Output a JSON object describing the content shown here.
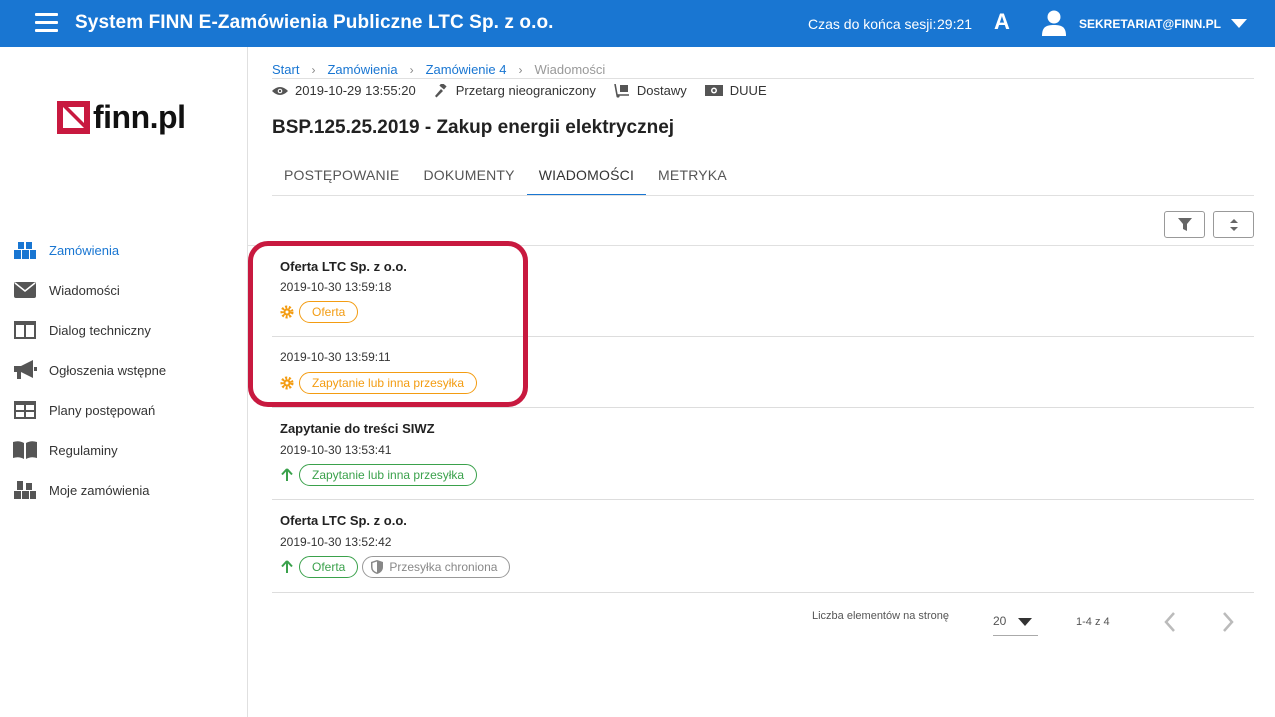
{
  "header": {
    "title": "System FINN E-Zamówienia Publiczne LTC Sp. z o.o.",
    "session_label": "Czas do końca sesji:",
    "session_time": "29:21",
    "font_toggle": "A",
    "user": "SEKRETARIAT@FINN.PL",
    "background": "#1976d2"
  },
  "sidebar": {
    "logo_text": "finn.pl",
    "logo_color": "#c8193f",
    "items": [
      {
        "label": "Zamówienia",
        "icon": "boxes-icon",
        "active": true
      },
      {
        "label": "Wiadomości",
        "icon": "envelope-icon"
      },
      {
        "label": "Dialog techniczny",
        "icon": "columns-icon"
      },
      {
        "label": "Ogłoszenia wstępne",
        "icon": "megaphone-icon"
      },
      {
        "label": "Plany postępowań",
        "icon": "table-icon"
      },
      {
        "label": "Regulaminy",
        "icon": "book-icon"
      },
      {
        "label": "Moje zamówienia",
        "icon": "stacked-boxes-icon"
      }
    ]
  },
  "breadcrumb": {
    "items": [
      "Start",
      "Zamówienia",
      "Zamówienie 4"
    ],
    "current": "Wiadomości"
  },
  "meta": {
    "date": "2019-10-29 13:55:20",
    "procedure": "Przetarg nieograniczony",
    "type": "Dostawy",
    "duue": "DUUE"
  },
  "page_title": "BSP.125.25.2019 - Zakup energii elektrycznej",
  "tabs": [
    "POSTĘPOWANIE",
    "DOKUMENTY",
    "WIADOMOŚCI",
    "METRYKA"
  ],
  "active_tab": "WIADOMOŚCI",
  "messages": [
    {
      "title": "Oferta LTC Sp. z o.o.",
      "date": "2019-10-30 13:59:18",
      "tags": [
        {
          "label": "Oferta",
          "color": "orange"
        }
      ],
      "icon": "gear-icon"
    },
    {
      "title": "",
      "date": "2019-10-30 13:59:11",
      "tags": [
        {
          "label": "Zapytanie lub inna przesyłka",
          "color": "orange"
        }
      ],
      "icon": "gear-icon"
    },
    {
      "title": "Zapytanie do treści SIWZ",
      "date": "2019-10-30 13:53:41",
      "tags": [
        {
          "label": "Zapytanie lub inna przesyłka",
          "color": "green"
        }
      ],
      "icon": "arrow-up-icon"
    },
    {
      "title": "Oferta LTC Sp. z o.o.",
      "date": "2019-10-30 13:52:42",
      "tags": [
        {
          "label": "Oferta",
          "color": "green"
        },
        {
          "label": "Przesyłka chroniona",
          "color": "grey"
        }
      ],
      "icon": "arrow-up-icon"
    }
  ],
  "pager": {
    "label": "Liczba elementów na stronę",
    "page_size": "20",
    "range": "1-4 z 4"
  }
}
